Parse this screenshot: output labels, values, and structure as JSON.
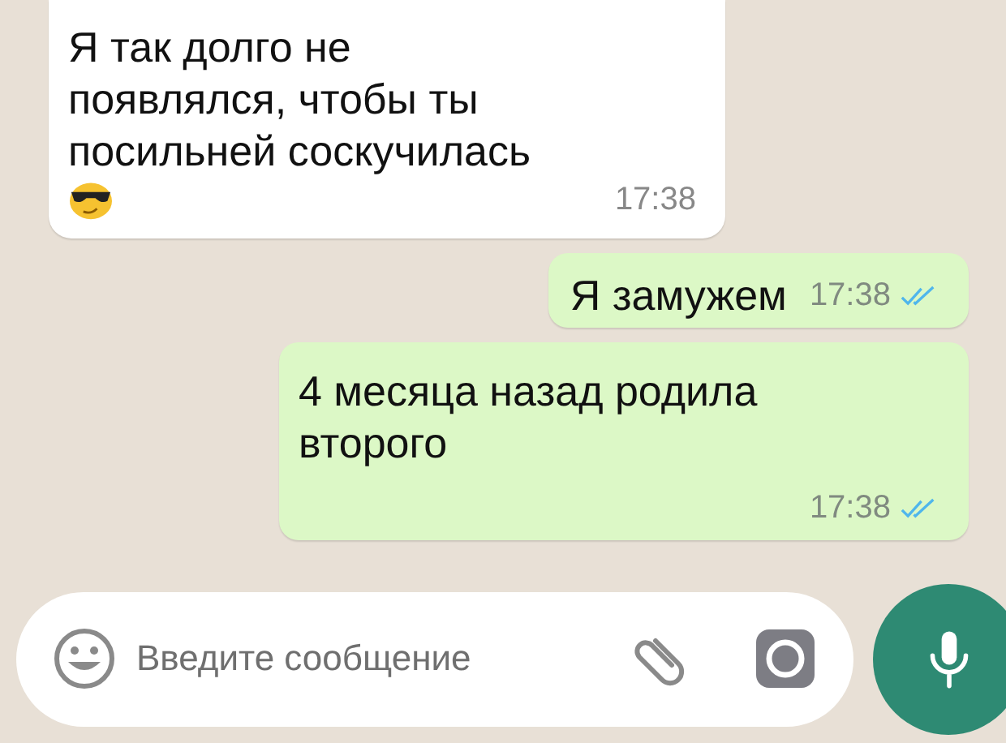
{
  "messages": [
    {
      "kind": "incoming",
      "text": "Я так долго не появлялся, чтобы ты посильней соскучилась",
      "emoji": true,
      "time": "17:38"
    },
    {
      "kind": "outgoing",
      "text": "Я замужем",
      "time": "17:38",
      "read": true
    },
    {
      "kind": "outgoing",
      "text": "4 месяца назад родила второго",
      "time": "17:38",
      "read": true
    }
  ],
  "composer": {
    "placeholder": "Введите сообщение"
  }
}
